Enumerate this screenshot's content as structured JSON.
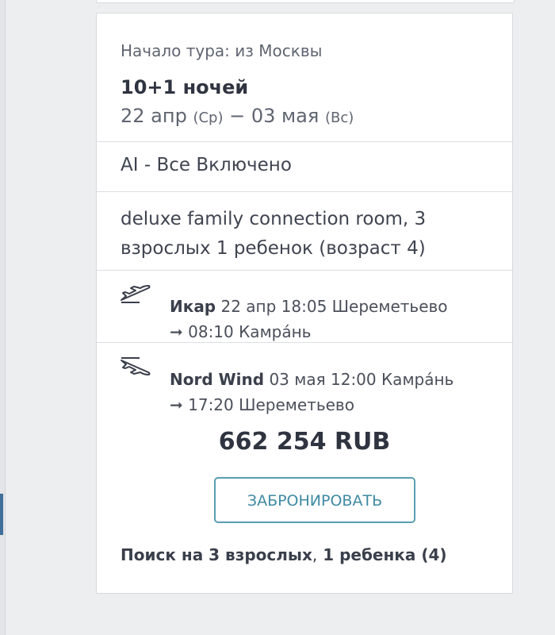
{
  "tour": {
    "start_label": "Начало тура: из Москвы",
    "nights": "10+1 ночей",
    "date_from": "22 апр",
    "weekday_from": "(Ср)",
    "dash": "−",
    "date_to": "03 мая",
    "weekday_to": "(Вс)"
  },
  "meal": "AI - Все Включено",
  "room": "deluxe family connection room, 3 взрослых 1 ребенок (возраст 4)",
  "flights": [
    {
      "icon": "plane-departure-icon",
      "airline": "Икар",
      "details": " 22 апр 18:05 Шереметьево",
      "arrival": "➞ 08:10 Камра́нь"
    },
    {
      "icon": "plane-arrival-icon",
      "airline": "Nord Wind",
      "details": " 03 мая 12:00 Камра́нь",
      "arrival": "➞ 17:20 Шереметьево"
    }
  ],
  "price": "662 254 RUB",
  "book_button": "ЗАБРОНИРОВАТЬ",
  "search": {
    "part1": "Поиск на 3 взрослых",
    "separator": ",",
    "part2": " 1 ребенка (4)"
  },
  "colors": {
    "accent": "#3f6f9a",
    "button_border": "#5a9db0",
    "button_text": "#3f8aa2"
  }
}
